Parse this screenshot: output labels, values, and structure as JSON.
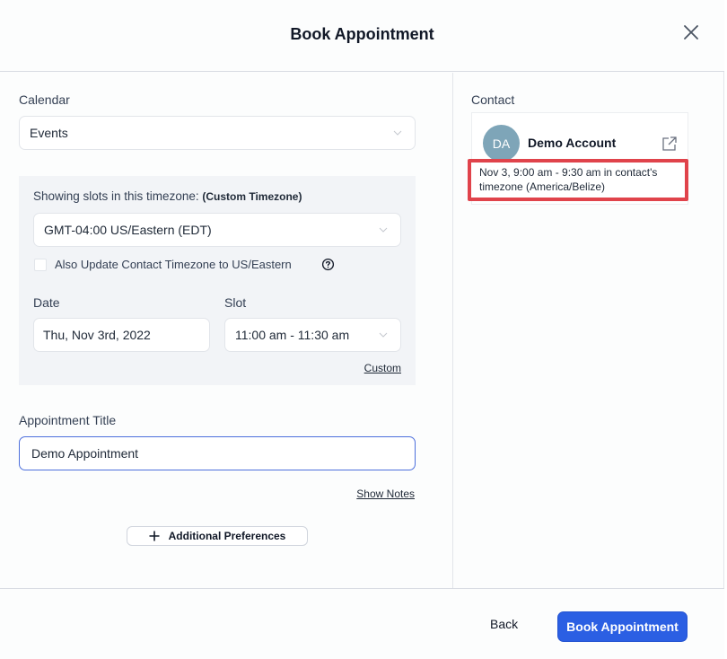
{
  "header": {
    "title": "Book Appointment",
    "close_icon": "close-icon"
  },
  "calendar": {
    "label": "Calendar",
    "value": "Events"
  },
  "timezone": {
    "label": "Showing slots in this timezone:",
    "label_suffix": "(Custom Timezone)",
    "value": "GMT-04:00 US/Eastern (EDT)",
    "update_contact_checkbox": {
      "label": "Also Update Contact Timezone to US/Eastern",
      "checked": false
    },
    "help_icon": "question-circle-icon"
  },
  "date": {
    "label": "Date",
    "value": "Thu, Nov 3rd, 2022"
  },
  "slot": {
    "label": "Slot",
    "value": "11:00 am - 11:30 am",
    "custom_link": "Custom"
  },
  "appointment_title": {
    "label": "Appointment Title",
    "value": "Demo Appointment"
  },
  "show_notes_link": "Show Notes",
  "additional_preferences_button": "Additional Preferences",
  "contact": {
    "label": "Contact",
    "initials": "DA",
    "name": "Demo Account",
    "avatar_color": "#7ea5b8",
    "timezone_note_line1": "Nov 3, 9:00 am - 9:30 am in contact's",
    "timezone_note_line2": "timezone (America/Belize)",
    "highlight_color": "#e0434b"
  },
  "footer": {
    "back_label": "Back",
    "book_label": "Book Appointment",
    "primary_color": "#2b5fe3"
  }
}
